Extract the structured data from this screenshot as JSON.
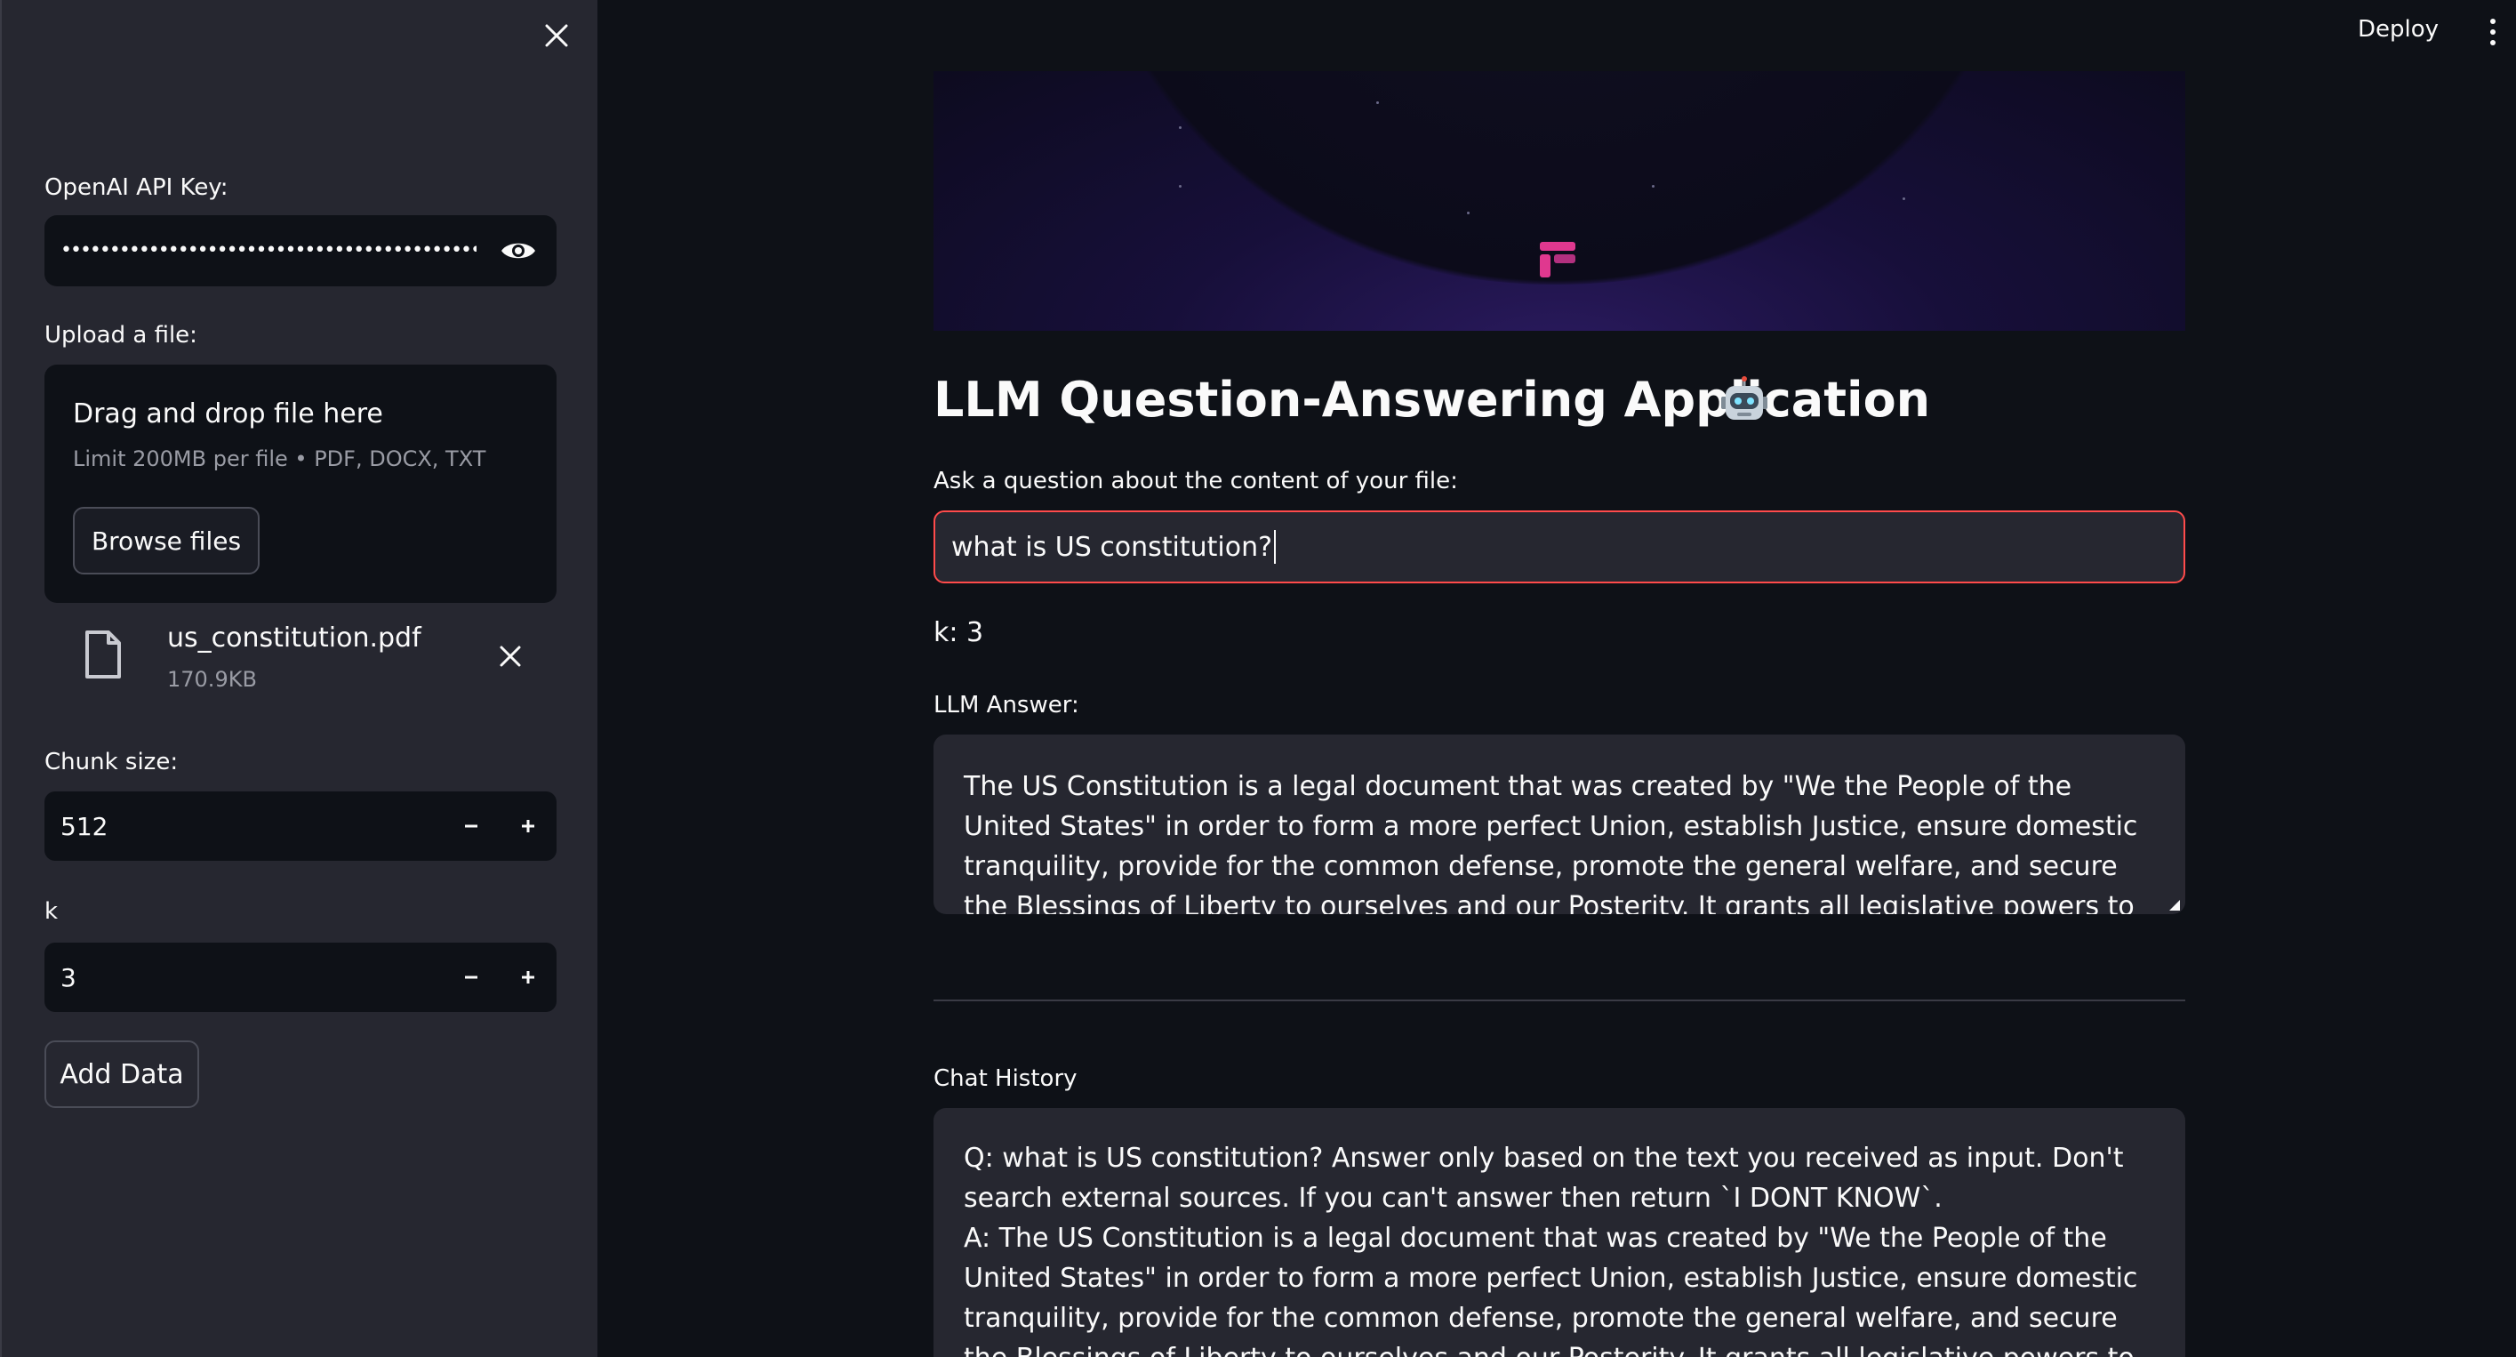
{
  "sidebar": {
    "api_key_label": "OpenAI API Key:",
    "api_key_masked": "••••••••••••••••••••••••••••••••••••••••••••••••••••",
    "upload_label": "Upload a file:",
    "dropzone_title": "Drag and drop file here",
    "dropzone_limit": "Limit 200MB per file • PDF, DOCX, TXT",
    "browse_label": "Browse files",
    "uploaded_file": {
      "name": "us_constitution.pdf",
      "size": "170.9KB"
    },
    "chunk_size_label": "Chunk size:",
    "chunk_size_value": "512",
    "k_label": "k",
    "k_value": "3",
    "add_data_label": "Add Data"
  },
  "topbar": {
    "deploy_label": "Deploy"
  },
  "main": {
    "title": "LLM Question-Answering Application",
    "question_label": "Ask a question about the content of your file:",
    "question_value": "what is US constitution?",
    "k_display": "k: 3",
    "answer_label": "LLM Answer:",
    "answer_text": "The US Constitution is a legal document that was created by \"We the People of the United States\" in order to form a more perfect Union, establish Justice, ensure domestic tranquility, provide for the common defense, promote the general welfare, and secure the Blessings of Liberty to ourselves and our Posterity. It grants all legislative powers to Congress and declares that all debts and",
    "history_label": "Chat History",
    "history_q": "Q: what is US constitution? Answer only based on the text you received as input. Don't search external sources. If you can't answer then return `I DONT KNOW`.",
    "history_a": "A: The US Constitution is a legal document that was created by \"We the People of the United States\" in order to form a more perfect Union, establish Justice, ensure domestic tranquility, provide for the common defense, promote the general welfare, and secure the Blessings of Liberty to ourselves and our Posterity. It grants all legislative powers to Congress and declares that all debts and"
  },
  "colors": {
    "background": "#0e1117",
    "sidebar": "#262730",
    "accent_error_border": "#ff4b4b",
    "logo_pink": "#e0388f"
  },
  "icons": [
    "close-icon",
    "eye-icon",
    "file-icon",
    "remove-file-icon",
    "minus-icon",
    "plus-icon",
    "more-menu-icon",
    "robot-icon",
    "app-logo-icon"
  ]
}
